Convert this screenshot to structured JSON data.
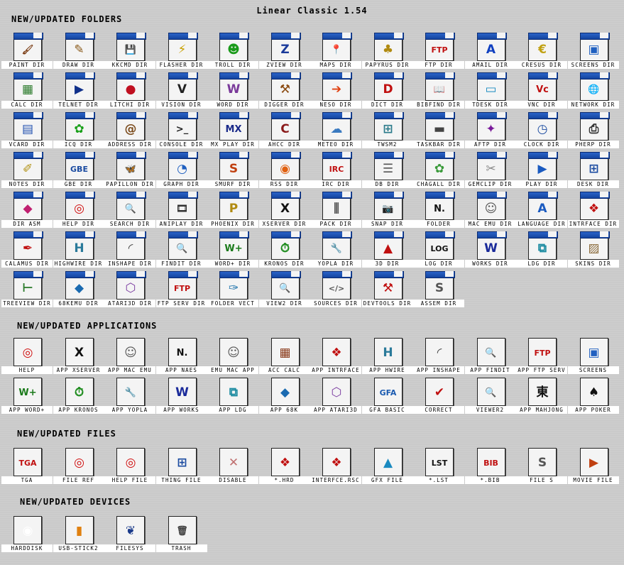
{
  "title": "Linear Classic 1.54",
  "sections": [
    {
      "heading": "NEW/UPDATED FOLDERS",
      "folder": true,
      "items": [
        {
          "label": "PAINT DIR",
          "icon": "paintbrush-icon",
          "glyph": "🖌",
          "color": "#7a3b12"
        },
        {
          "label": "DRAW DIR",
          "icon": "pencil-icon",
          "glyph": "✎",
          "color": "#8a5a1a"
        },
        {
          "label": "KKCMD DIR",
          "icon": "floppy-disk-icon",
          "glyph": "💾",
          "color": "#333333"
        },
        {
          "label": "FLASHER DIR",
          "icon": "chip-icon",
          "glyph": "⚡",
          "color": "#c8a000"
        },
        {
          "label": "TROLL DIR",
          "icon": "troll-icon",
          "glyph": "☻",
          "color": "#1a9a1a"
        },
        {
          "label": "ZVIEW DIR",
          "icon": "zview-icon",
          "glyph": "Z",
          "color": "#1a3a9a"
        },
        {
          "label": "MAPS DIR",
          "icon": "map-pin-icon",
          "glyph": "📍",
          "color": "#c01010"
        },
        {
          "label": "PAPYRUS DIR",
          "icon": "papyrus-plant-icon",
          "glyph": "♣",
          "color": "#b08a10"
        },
        {
          "label": "FTP DIR",
          "icon": "ftp-icon",
          "glyph": "FTP",
          "color": "#c01010"
        },
        {
          "label": "AMAIL DIR",
          "icon": "amail-icon",
          "glyph": "A",
          "color": "#1040c0"
        },
        {
          "label": "CRESUS DIR",
          "icon": "cresus-icon",
          "glyph": "€",
          "color": "#c0a010"
        },
        {
          "label": "SCREENS DIR",
          "icon": "screens-icon",
          "glyph": "▣",
          "color": "#2060c0"
        },
        {
          "label": "CALC DIR",
          "icon": "spreadsheet-icon",
          "glyph": "▦",
          "color": "#2a7a2a"
        },
        {
          "label": "TELNET DIR",
          "icon": "terminal-icon",
          "glyph": "▶",
          "color": "#10308a"
        },
        {
          "label": "LITCHI DIR",
          "icon": "litchi-fruit-icon",
          "glyph": "●",
          "color": "#c01020"
        },
        {
          "label": "VISION DIR",
          "icon": "vision-icon",
          "glyph": "V",
          "color": "#222222"
        },
        {
          "label": "WORD DIR",
          "icon": "word-document-icon",
          "glyph": "W",
          "color": "#7a3a9a"
        },
        {
          "label": "DIGGER DIR",
          "icon": "pickaxe-icon",
          "glyph": "⚒",
          "color": "#8a4a10"
        },
        {
          "label": "NESO DIR",
          "icon": "neso-arrow-icon",
          "glyph": "➔",
          "color": "#e04010"
        },
        {
          "label": "DICT DIR",
          "icon": "dictionary-icon",
          "glyph": "D",
          "color": "#c01010"
        },
        {
          "label": "BIBFIND DIR",
          "icon": "book-search-icon",
          "glyph": "📖",
          "color": "#c01010"
        },
        {
          "label": "TDESK DIR",
          "icon": "desktop-icon",
          "glyph": "▭",
          "color": "#1a8ac0"
        },
        {
          "label": "VNC DIR",
          "icon": "vnc-icon",
          "glyph": "Vc",
          "color": "#c01010"
        },
        {
          "label": "NETWORK DIR",
          "icon": "network-globe-icon",
          "glyph": "🌐",
          "color": "#333333"
        },
        {
          "label": "VCARD DIR",
          "icon": "vcard-icon",
          "glyph": "▤",
          "color": "#2050b0"
        },
        {
          "label": "ICQ DIR",
          "icon": "icq-flower-icon",
          "glyph": "✿",
          "color": "#1aa01a"
        },
        {
          "label": "ADDRESS DIR",
          "icon": "address-book-icon",
          "glyph": "@",
          "color": "#7a4a1a"
        },
        {
          "label": "CONSOLE DIR",
          "icon": "console-icon",
          "glyph": ">_",
          "color": "#222222"
        },
        {
          "label": "MX PLAY DIR",
          "icon": "mxplay-icon",
          "glyph": "MX",
          "color": "#1a2a8a"
        },
        {
          "label": "AHCC DIR",
          "icon": "ahcc-icon",
          "glyph": "C",
          "color": "#8a1a1a"
        },
        {
          "label": "METEO DIR",
          "icon": "weather-icon",
          "glyph": "☁",
          "color": "#3a7ac0"
        },
        {
          "label": "TWSM2",
          "icon": "windows-icon",
          "glyph": "⊞",
          "color": "#2a7a8a"
        },
        {
          "label": "TASKBAR DIR",
          "icon": "taskbar-icon",
          "glyph": "▬",
          "color": "#444444"
        },
        {
          "label": "AFTP DIR",
          "icon": "aftp-icon",
          "glyph": "✦",
          "color": "#7a1a9a"
        },
        {
          "label": "CLOCK DIR",
          "icon": "clock-icon",
          "glyph": "◷",
          "color": "#1a4aa0"
        },
        {
          "label": "PHERP DIR",
          "icon": "printer-icon",
          "glyph": "⎙",
          "color": "#333333"
        },
        {
          "label": "NOTES DIR",
          "icon": "notes-icon",
          "glyph": "✐",
          "color": "#b09010"
        },
        {
          "label": "GBE DIR",
          "icon": "gbe-icon",
          "glyph": "GBE",
          "color": "#1a4aa0"
        },
        {
          "label": "PAPILLON DIR",
          "icon": "butterfly-icon",
          "glyph": "🦋",
          "color": "#d07010"
        },
        {
          "label": "GRAPH DIR",
          "icon": "pie-chart-icon",
          "glyph": "◔",
          "color": "#2060c0"
        },
        {
          "label": "SMURF DIR",
          "icon": "smurf-icon",
          "glyph": "S",
          "color": "#c04010"
        },
        {
          "label": "RSS DIR",
          "icon": "rss-icon",
          "glyph": "◉",
          "color": "#e06010"
        },
        {
          "label": "IRC DIR",
          "icon": "irc-icon",
          "glyph": "IRC",
          "color": "#c01010"
        },
        {
          "label": "DB DIR",
          "icon": "database-icon",
          "glyph": "☰",
          "color": "#555555"
        },
        {
          "label": "CHAGALL DIR",
          "icon": "chagall-icon",
          "glyph": "✿",
          "color": "#3a9a3a"
        },
        {
          "label": "GEMCLIP DIR",
          "icon": "clipboard-icon",
          "glyph": "✂",
          "color": "#8a8a8a"
        },
        {
          "label": "PLAY DIR",
          "icon": "play-icon",
          "glyph": "▶",
          "color": "#1a5ac0"
        },
        {
          "label": "DESK DIR",
          "icon": "desk-grid-icon",
          "glyph": "⊞",
          "color": "#1a4aa0"
        },
        {
          "label": "DIR ASM",
          "icon": "asm-icon",
          "glyph": "◆",
          "color": "#c02070"
        },
        {
          "label": "HELP DIR",
          "icon": "lifebuoy-icon",
          "glyph": "◎",
          "color": "#d01010"
        },
        {
          "label": "SEARCH DIR",
          "icon": "magnifier-icon",
          "glyph": "🔍",
          "color": "#2a6ab0"
        },
        {
          "label": "ANIPLAY DIR",
          "icon": "film-icon",
          "glyph": "🎞",
          "color": "#333333"
        },
        {
          "label": "PHOENIX DIR",
          "icon": "phoenix-icon",
          "glyph": "P",
          "color": "#b08a10"
        },
        {
          "label": "XSERVER DIR",
          "icon": "x-server-icon",
          "glyph": "X",
          "color": "#111111"
        },
        {
          "label": "PACK DIR",
          "icon": "zip-icon",
          "glyph": "⫼",
          "color": "#555555"
        },
        {
          "label": "SNAP DIR",
          "icon": "camera-icon",
          "glyph": "📷",
          "color": "#333333"
        },
        {
          "label": "FOLDER",
          "icon": "naes-icon",
          "glyph": "N.",
          "color": "#111111"
        },
        {
          "label": "MAC EMU DIR",
          "icon": "mac-icon",
          "glyph": "☺",
          "color": "#555555"
        },
        {
          "label": "LANGUAGE DIR",
          "icon": "language-icon",
          "glyph": "A",
          "color": "#1a5ac0"
        },
        {
          "label": "INTRFACE DIR",
          "icon": "interface-icon",
          "glyph": "❖",
          "color": "#c01010"
        },
        {
          "label": "CALAMUS DIR",
          "icon": "quill-icon",
          "glyph": "✒",
          "color": "#c01010"
        },
        {
          "label": "HIGHWIRE DIR",
          "icon": "highwire-icon",
          "glyph": "H",
          "color": "#2a7a9a"
        },
        {
          "label": "INSHAPE DIR",
          "icon": "inshape-icon",
          "glyph": "◜",
          "color": "#444444"
        },
        {
          "label": "FINDIT DIR",
          "icon": "find-icon",
          "glyph": "🔍",
          "color": "#1a4aa0"
        },
        {
          "label": "WORD+ DIR",
          "icon": "wordplus-icon",
          "glyph": "W+",
          "color": "#1a7a1a"
        },
        {
          "label": "KRONOS DIR",
          "icon": "stopwatch-icon",
          "glyph": "⏱",
          "color": "#1a8a1a"
        },
        {
          "label": "YOPLA DIR",
          "icon": "wrench-icon",
          "glyph": "🔧",
          "color": "#555555"
        },
        {
          "label": "3D DIR",
          "icon": "3d-shapes-icon",
          "glyph": "▲",
          "color": "#c01010"
        },
        {
          "label": "LOG DIR",
          "icon": "log-icon",
          "glyph": "LOG",
          "color": "#111111"
        },
        {
          "label": "WORKS DIR",
          "icon": "works-icon",
          "glyph": "W",
          "color": "#1a2a9a"
        },
        {
          "label": "LDG DIR",
          "icon": "ldg-puzzle-icon",
          "glyph": "⧉",
          "color": "#1a8aa0"
        },
        {
          "label": "SKINS DIR",
          "icon": "skins-icon",
          "glyph": "▨",
          "color": "#8a6a3a"
        },
        {
          "label": "TREEVIEW DIR",
          "icon": "tree-icon",
          "glyph": "⊢",
          "color": "#2a7a2a"
        },
        {
          "label": "68KEMU DIR",
          "icon": "68k-chip-icon",
          "glyph": "◆",
          "color": "#1a6ab0"
        },
        {
          "label": "ATARI3D DIR",
          "icon": "cube-icon",
          "glyph": "⬡",
          "color": "#7a3aa0"
        },
        {
          "label": "FTP SERV DIR",
          "icon": "ftp-server-icon",
          "glyph": "FTP",
          "color": "#c01010"
        },
        {
          "label": "FOLDER VECT",
          "icon": "vector-icon",
          "glyph": "✑",
          "color": "#2a7ab0"
        },
        {
          "label": "VIEW2 DIR",
          "icon": "viewer-icon",
          "glyph": "🔍",
          "color": "#2a8a9a"
        },
        {
          "label": "SOURCES DIR",
          "icon": "code-icon",
          "glyph": "</>",
          "color": "#555555"
        },
        {
          "label": "DEVTOOLS DIR",
          "icon": "hammer-icon",
          "glyph": "⚒",
          "color": "#c01010"
        },
        {
          "label": "ASSEM DIR",
          "icon": "assem-icon",
          "glyph": "S",
          "color": "#555555"
        }
      ]
    },
    {
      "heading": "NEW/UPDATED APPLICATIONS",
      "folder": false,
      "items": [
        {
          "label": "HELP",
          "icon": "lifebuoy-icon",
          "glyph": "◎",
          "color": "#d01010"
        },
        {
          "label": "APP XSERVER",
          "icon": "x-server-icon",
          "glyph": "X",
          "color": "#111111"
        },
        {
          "label": "APP MAC EMU",
          "icon": "mac-icon",
          "glyph": "☺",
          "color": "#555555"
        },
        {
          "label": "APP NAES",
          "icon": "naes-icon",
          "glyph": "N.",
          "color": "#111111"
        },
        {
          "label": "EMU MAC APP",
          "icon": "mac-window-icon",
          "glyph": "☺",
          "color": "#555555"
        },
        {
          "label": "ACC CALC",
          "icon": "calculator-icon",
          "glyph": "▦",
          "color": "#8a3a1a"
        },
        {
          "label": "APP INTRFACE",
          "icon": "interface-icon",
          "glyph": "❖",
          "color": "#c01010"
        },
        {
          "label": "APP HWIRE",
          "icon": "highwire-icon",
          "glyph": "H",
          "color": "#2a7a9a"
        },
        {
          "label": "APP INSHAPE",
          "icon": "inshape-icon",
          "glyph": "◜",
          "color": "#444444"
        },
        {
          "label": "APP FINDIT",
          "icon": "find-icon",
          "glyph": "🔍",
          "color": "#1a4aa0"
        },
        {
          "label": "APP FTP SERV",
          "icon": "ftp-server-icon",
          "glyph": "FTP",
          "color": "#c01010"
        },
        {
          "label": "SCREENS",
          "icon": "screens-icon",
          "glyph": "▣",
          "color": "#2060c0"
        },
        {
          "label": "APP WORD+",
          "icon": "wordplus-icon",
          "glyph": "W+",
          "color": "#1a7a1a"
        },
        {
          "label": "APP KRONOS",
          "icon": "stopwatch-icon",
          "glyph": "⏱",
          "color": "#1a8a1a"
        },
        {
          "label": "APP YOPLA",
          "icon": "wrench-icon",
          "glyph": "🔧",
          "color": "#555555"
        },
        {
          "label": "APP WORKS",
          "icon": "works-icon",
          "glyph": "W",
          "color": "#1a2a9a"
        },
        {
          "label": "APP LDG",
          "icon": "ldg-puzzle-icon",
          "glyph": "⧉",
          "color": "#1a8aa0"
        },
        {
          "label": "APP 68K",
          "icon": "68k-chip-icon",
          "glyph": "◆",
          "color": "#1a6ab0"
        },
        {
          "label": "APP ATARI3D",
          "icon": "cube-icon",
          "glyph": "⬡",
          "color": "#7a3aa0"
        },
        {
          "label": "GFA BASIC",
          "icon": "gfa-basic-icon",
          "glyph": "GFA",
          "color": "#1a5ab0"
        },
        {
          "label": "CORRECT",
          "icon": "correct-icon",
          "glyph": "✔",
          "color": "#c01010"
        },
        {
          "label": "VIEWER2",
          "icon": "viewer-icon",
          "glyph": "🔍",
          "color": "#2a8a9a"
        },
        {
          "label": "APP MAHJONG",
          "icon": "mahjong-tile-icon",
          "glyph": "東",
          "color": "#111111"
        },
        {
          "label": "APP POKER",
          "icon": "playing-cards-icon",
          "glyph": "♠",
          "color": "#111111"
        }
      ]
    },
    {
      "heading": "NEW/UPDATED FILES",
      "folder": false,
      "items": [
        {
          "label": "TGA",
          "icon": "tga-image-icon",
          "glyph": "TGA",
          "color": "#c01010"
        },
        {
          "label": "FILE REF",
          "icon": "lifebuoy-file-icon",
          "glyph": "◎",
          "color": "#d01010"
        },
        {
          "label": "HELP FILE",
          "icon": "lifebuoy-icon",
          "glyph": "◎",
          "color": "#d01010"
        },
        {
          "label": "THING FILE",
          "icon": "thing-icon",
          "glyph": "⊞",
          "color": "#1a4aa0"
        },
        {
          "label": "DISABLE",
          "icon": "disabled-icon",
          "glyph": "✕",
          "color": "#c07070"
        },
        {
          "label": "*.HRD",
          "icon": "hrd-file-icon",
          "glyph": "❖",
          "color": "#c01010"
        },
        {
          "label": "INTERFCE.RSC",
          "icon": "rsc-file-icon",
          "glyph": "❖",
          "color": "#c01010"
        },
        {
          "label": "GFX FILE",
          "icon": "gfx-shapes-icon",
          "glyph": "▲",
          "color": "#1a8ac0"
        },
        {
          "label": "*.LST",
          "icon": "lst-file-icon",
          "glyph": "LST",
          "color": "#111111"
        },
        {
          "label": "*.BIB",
          "icon": "bib-file-icon",
          "glyph": "BIB",
          "color": "#c01010"
        },
        {
          "label": "FILE S",
          "icon": "s-file-icon",
          "glyph": "S",
          "color": "#555555"
        },
        {
          "label": "MOVIE FILE",
          "icon": "movie-icon",
          "glyph": "▶",
          "color": "#c04010"
        }
      ]
    },
    {
      "heading": "NEW/UPDATED DEVICES",
      "folder": false,
      "items": [
        {
          "label": "HARDDISK",
          "icon": "harddisk-icon",
          "glyph": "◉",
          "color": "#ffffff"
        },
        {
          "label": "USB-STICK2",
          "icon": "usb-stick-icon",
          "glyph": "▮",
          "color": "#e08010"
        },
        {
          "label": "FILESYS",
          "icon": "filesys-icon",
          "glyph": "❦",
          "color": "#1a3a8a"
        },
        {
          "label": "TRASH",
          "icon": "trash-can-icon",
          "glyph": "🗑",
          "color": "#444444"
        }
      ]
    }
  ]
}
